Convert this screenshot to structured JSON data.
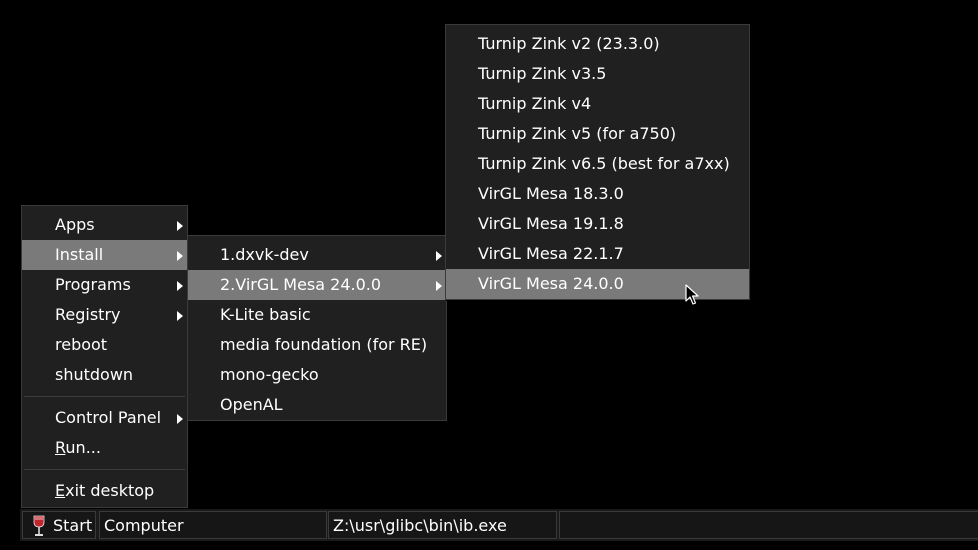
{
  "start_menu": {
    "items": [
      {
        "label": "Apps"
      },
      {
        "label": "Install"
      },
      {
        "label": "Programs"
      },
      {
        "label": "Registry"
      },
      {
        "label": "reboot"
      },
      {
        "label": "shutdown"
      },
      {
        "label": "Control Panel"
      },
      {
        "label_ul": "R",
        "label_rest": "un..."
      },
      {
        "label_ul": "E",
        "label_rest": "xit desktop"
      }
    ]
  },
  "install_menu": {
    "items": [
      {
        "label": "1.dxvk-dev"
      },
      {
        "label": "2.VirGL Mesa 24.0.0"
      },
      {
        "label": "K-Lite basic"
      },
      {
        "label": "media foundation (for RE)"
      },
      {
        "label": "mono-gecko"
      },
      {
        "label": "OpenAL"
      }
    ]
  },
  "virgl_menu": {
    "items": [
      {
        "label": "Turnip Zink v2 (23.3.0)"
      },
      {
        "label": "Turnip Zink v3.5"
      },
      {
        "label": "Turnip Zink v4"
      },
      {
        "label": "Turnip Zink v5 (for a750)"
      },
      {
        "label": "Turnip Zink v6.5 (best for a7xx)"
      },
      {
        "label": "VirGL Mesa 18.3.0"
      },
      {
        "label": "VirGL Mesa 19.1.8"
      },
      {
        "label": "VirGL Mesa 22.1.7"
      },
      {
        "label": "VirGL Mesa 24.0.0"
      }
    ]
  },
  "taskbar": {
    "start_label": "Start",
    "start_icon": "wine-glass-icon",
    "tasks": [
      {
        "label": "Computer"
      },
      {
        "label": "Z:\\usr\\glibc\\bin\\ib.exe"
      }
    ]
  },
  "colors": {
    "menu_bg": "#202020",
    "selected_bg": "#7a7a7a",
    "desktop_bg": "#000000",
    "wine_red": "#c0262e"
  }
}
